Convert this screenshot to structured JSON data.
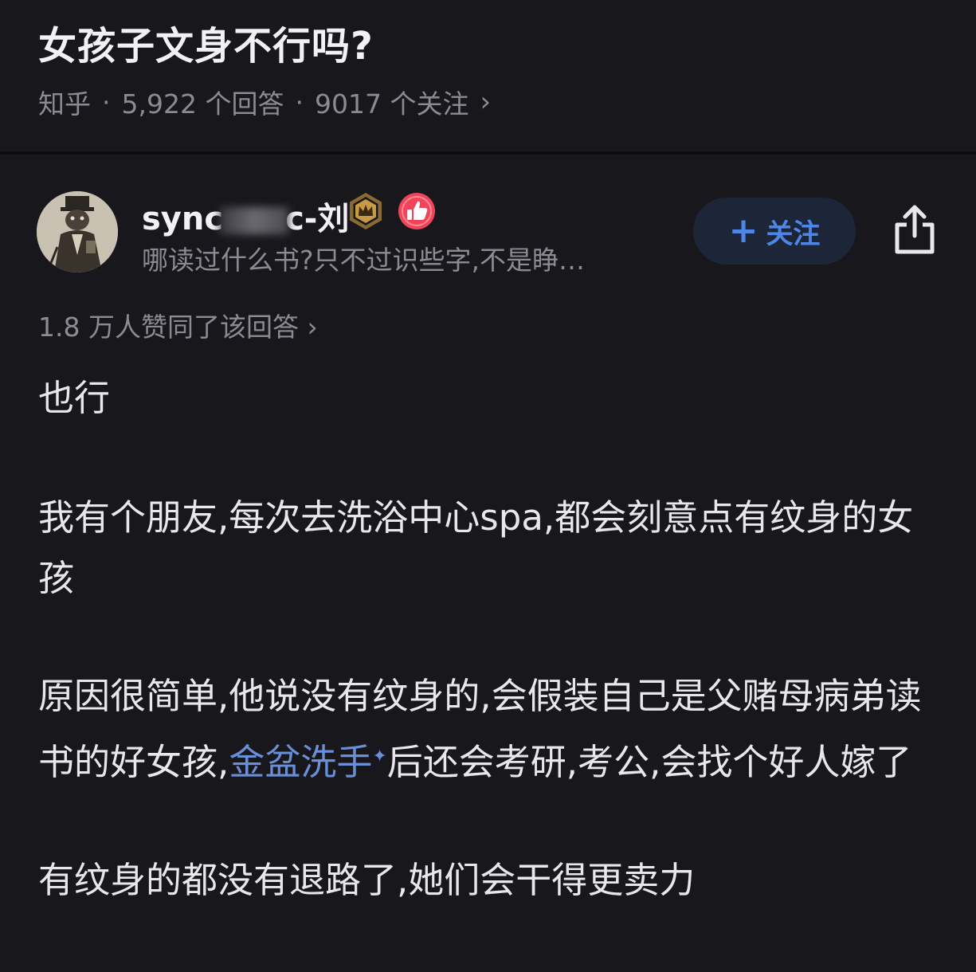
{
  "question": {
    "title": "女孩子文身不行吗?",
    "source": "知乎",
    "answers": "5,922 个回答",
    "follows": "9017 个关注",
    "separator": "·",
    "chevron": "›"
  },
  "author": {
    "name_prefix": "sync",
    "name_suffix": "c-刘",
    "bio": "哪读过什么书?只不过识些字,不是睁…",
    "follow_label": "关注",
    "follow_icon": "plus-icon",
    "share_icon": "share-icon",
    "badges": [
      "crown-badge-icon",
      "thumbs-up-badge-icon"
    ]
  },
  "answer": {
    "upvote_text": "1.8 万人赞同了该回答",
    "upvote_chevron": "›",
    "paragraphs": {
      "p1": "也行",
      "p2": "我有个朋友,每次去洗浴中心spa,都会刻意点有纹身的女孩",
      "p3_before": "原因很简单,他说没有纹身的,会假装自己是父赌母病弟读书的好女孩,",
      "p3_link": "金盆洗手",
      "p3_link_mark": "✦",
      "p3_after": "后还会考研,考公,会找个好人嫁了",
      "p4": "有纹身的都没有退路了,她们会干得更卖力"
    }
  },
  "colors": {
    "background": "#17171c",
    "text": "#e8e8ec",
    "muted": "#8b8b93",
    "accent": "#4e86e8",
    "link": "#6a8fd6"
  }
}
